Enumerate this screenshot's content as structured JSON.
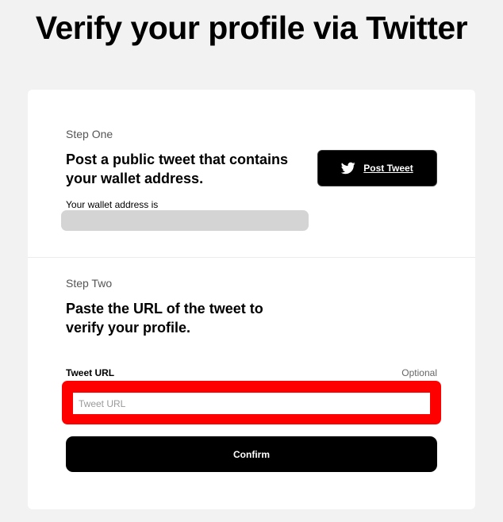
{
  "page": {
    "title": "Verify your profile via Twitter"
  },
  "step_one": {
    "label": "Step One",
    "heading_line1": "Post a public tweet that contains",
    "heading_line2": "your wallet address.",
    "wallet_label": "Your wallet address is",
    "wallet_value": "",
    "post_button_label": "Post Tweet",
    "post_button_icon": "twitter-bird-icon"
  },
  "step_two": {
    "label": "Step Two",
    "heading_line1": "Paste the URL of the tweet to",
    "heading_line2": "verify your profile.",
    "field_label": "Tweet URL",
    "optional_label": "Optional",
    "input_value": "",
    "input_placeholder": "Tweet URL",
    "confirm_label": "Confirm"
  },
  "colors": {
    "background": "#f2f2f2",
    "card": "#ffffff",
    "button": "#000000",
    "highlight": "#ff0000",
    "wallet_box": "#d4d4d4"
  }
}
